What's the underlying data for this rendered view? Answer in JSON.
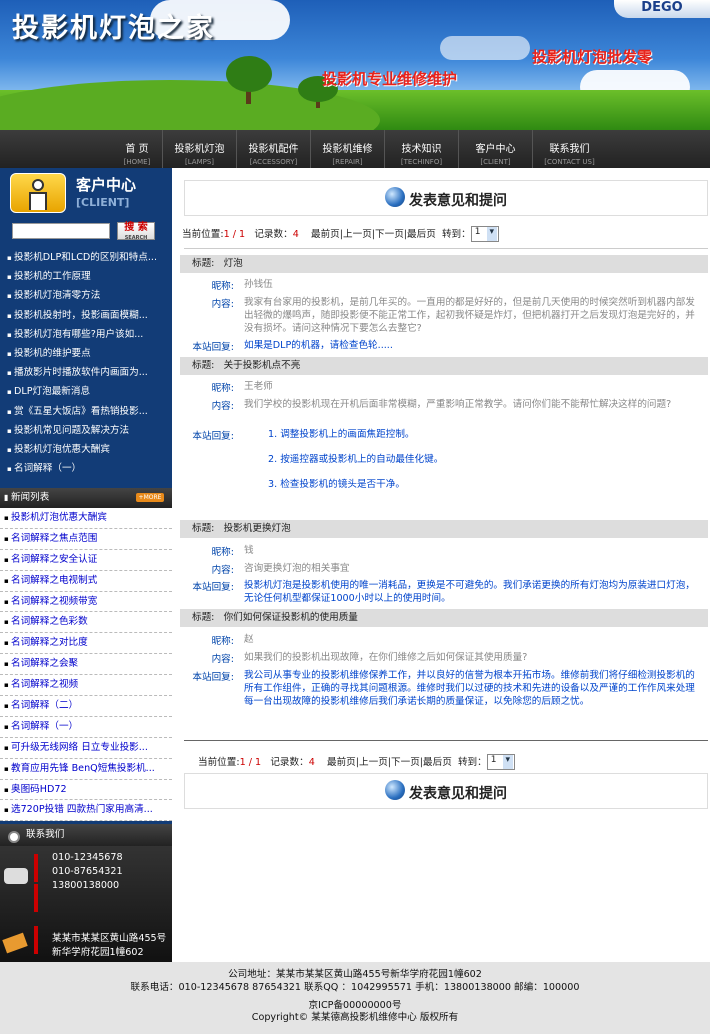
{
  "header": {
    "site_title": "投影机灯泡之家",
    "slogan_repair": "投影机专业维修维护",
    "slogan_wholesale": "投影机灯泡批发零",
    "brand": "DEGO"
  },
  "nav": [
    {
      "cn": "首 页",
      "en": "[HOME]"
    },
    {
      "cn": "投影机灯泡",
      "en": "[LAMPS]"
    },
    {
      "cn": "投影机配件",
      "en": "[ACCESSORY]"
    },
    {
      "cn": "投影机维修",
      "en": "[REPAIR]"
    },
    {
      "cn": "技术知识",
      "en": "[TECHINFO]"
    },
    {
      "cn": "客户中心",
      "en": "[CLIENT]"
    },
    {
      "cn": "联系我们",
      "en": "[CONTACT US]"
    }
  ],
  "sidebar": {
    "client_title": "客户中心",
    "client_sub": "[CLIENT]",
    "search_label": "搜 索",
    "search_sub": "SEARCH",
    "articles": [
      "投影机DLP和LCD的区别和特点...",
      "投影机的工作原理",
      "投影机灯泡清零方法",
      "投影机投射时，投影画面模糊...",
      "投影机灯泡有哪些?用户该如...",
      "投影机的维护要点",
      "播放影片时播放软件内画面为...",
      "DLP灯泡最新消息",
      "赏《五星大饭店》看热销投影...",
      "投影机常见问题及解决方法",
      "投影机灯泡优惠大酬宾",
      "名词解释（一）"
    ],
    "news_title": "新闻列表",
    "more": "+MORE",
    "news": [
      "投影机灯泡优惠大酬宾",
      "名词解释之焦点范围",
      "名词解释之安全认证",
      "名词解释之电视制式",
      "名词解释之视频带宽",
      "名词解释之色彩数",
      "名词解释之对比度",
      "名词解释之会聚",
      "名词解释之视频",
      "名词解释（二）",
      "名词解释（一）",
      "可升级无线网络 日立专业投影...",
      "教育应用先锋 BenQ短焦投影机...",
      "奥图码HD72",
      "选720P投错 四款热门家用高清..."
    ],
    "contact_title": "联系我们",
    "phones": [
      "010-12345678",
      "010-87654321",
      "13800138000"
    ],
    "address": [
      "某某市某某区黄山路455号",
      "新华学府花园1幢602"
    ]
  },
  "main": {
    "section_title": "发表意见和提问",
    "pager": {
      "pos_label": "当前位置:",
      "pos_value": "1 / 1",
      "count_label": "记录数：",
      "count_value": "4",
      "links": "最前页|上一页|下一页|最后页",
      "goto_label": "转到：",
      "page_select": "1"
    },
    "labels": {
      "title": "标题:",
      "nick": "昵称:",
      "content": "内容:",
      "reply": "本站回复:"
    },
    "messages": [
      {
        "title": "灯泡",
        "nick": "孙钱伍",
        "content": "我家有台家用的投影机，是前几年买的。一直用的都是好好的，但是前几天使用的时候突然听到机器内部发出轻微的爆鸣声，随即投影便不能正常工作，起初我怀疑是炸灯，但把机器打开之后发现灯泡是完好的，并没有损坏。请问这种情况下要怎么去整它?",
        "reply": "如果是DLP的机器，请检查色轮....."
      },
      {
        "title": "关于投影机点不亮",
        "nick": "王老师",
        "content": "我们学校的投影机现在开机后面非常模糊，严重影响正常教学。请问你们能不能帮忙解决这样的问题?",
        "reply_items": [
          "1. 调整投影机上的画面焦距控制。",
          "2. 按遥控器或投影机上的自动最佳化键。",
          "3. 检查投影机的镜头是否干净。"
        ]
      },
      {
        "title": "投影机更换灯泡",
        "nick": "钱",
        "content": "咨询更换灯泡的相关事宜",
        "reply": "投影机灯泡是投影机使用的唯一消耗品，更换是不可避免的。我们承诺更换的所有灯泡均为原装进口灯泡，无论任何机型都保证1000小时以上的使用时间。"
      },
      {
        "title": "你们如何保证投影机的使用质量",
        "nick": "赵",
        "content": "如果我们的投影机出现故障，在你们维修之后如何保证其使用质量?",
        "reply": "我公司从事专业的投影机维修保养工作，并以良好的信誉为根本开拓市场。维修前我们将仔细检测投影机的所有工作组件，正确的寻找其问题根源。维修时我们以过硬的技术和先进的设备以及严谨的工作作风来处理每一台出现故障的投影机维修后我们承诺长期的质量保证，以免除您的后顾之忧。"
      }
    ]
  },
  "footer": {
    "address": "公司地址：某某市某某区黄山路455号新华学府花园1幢602",
    "phones": "联系电话：010-12345678  87654321   联系QQ ：1042995571   手机：13800138000   邮编：100000",
    "icp": "京ICP备00000000号",
    "copyright": "Copyright© 某某德高投影机维修中心 版权所有"
  }
}
